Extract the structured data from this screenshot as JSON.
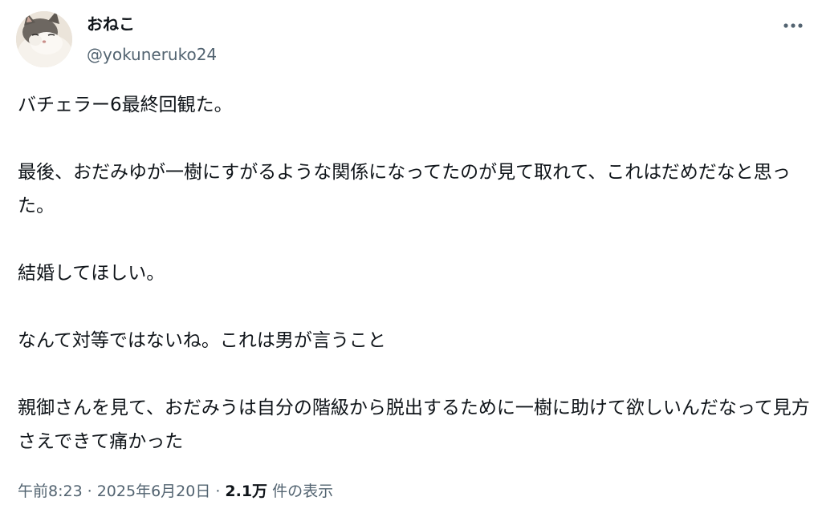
{
  "author": {
    "display_name": "おねこ",
    "handle": "@yokuneruko24"
  },
  "post": {
    "paragraphs": [
      "バチェラー6最終回観た。",
      "最後、おだみゆが一樹にすがるような関係になってたのが見て取れて、これはだめだなと思った。",
      "結婚してほしい。",
      "なんて対等ではないね。これは男が言うこと",
      "親御さんを見て、おだみうは自分の階級から脱出するために一樹に助けて欲しいんだなって見方さえできて痛かった"
    ]
  },
  "meta": {
    "time": "午前8:23",
    "separator": "·",
    "date": "2025年6月20日",
    "views_count": "2.1万",
    "views_label": "件の表示"
  },
  "icons": {
    "more": "more-horizontal-icon",
    "avatar": "cat-avatar"
  },
  "colors": {
    "text_primary": "#0f1419",
    "text_secondary": "#536471"
  }
}
